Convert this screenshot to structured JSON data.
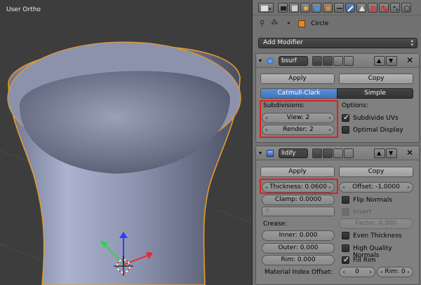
{
  "viewport": {
    "title": "User Ortho"
  },
  "context": {
    "object_name": "Circle"
  },
  "add_modifier": {
    "label": "Add Modifier"
  },
  "modifier1": {
    "name": "bsurf",
    "apply": "Apply",
    "copy": "Copy",
    "type_a": "Catmull-Clark",
    "type_b": "Simple",
    "subdivisions_label": "Subdivisions:",
    "view": "View: 2",
    "render": "Render: 2",
    "options_label": "Options:",
    "subdivide_uvs": "Subdivide UVs",
    "optimal_display": "Optimal Display"
  },
  "modifier2": {
    "name": "lidify",
    "apply": "Apply",
    "copy": "Copy",
    "thickness": "Thickness: 0.0600",
    "offset": "Offset: -1.0000",
    "clamp": "Clamp: 0.0000",
    "flip_normals": "Flip Normals",
    "invert": "Invert",
    "factor": "Factor: 0.000",
    "crease_label": "Crease:",
    "inner": "Inner: 0.000",
    "outer": "Outer: 0.000",
    "rim": "Rim: 0.000",
    "even_thickness": "Even Thickness",
    "high_quality_normals": "High Quality Normals",
    "fill_rim": "Fill Rim",
    "material_index_label": "Material Index Offset:",
    "mat_val": "0",
    "mat_rim": "Rim: 0"
  },
  "colors": {
    "accent": "#4f86cc",
    "highlight": "#e21e1e",
    "panel": "#727272",
    "viewport": "#3d3d3d"
  }
}
